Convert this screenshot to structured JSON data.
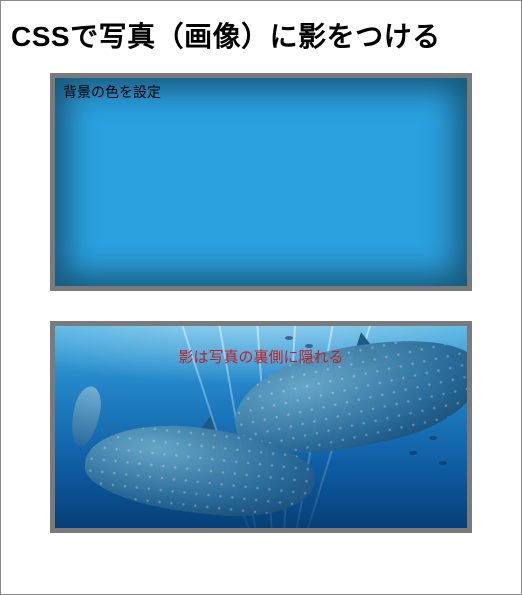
{
  "title": "CSSで写真（画像）に影をつける",
  "box1": {
    "label": "背景の色を設定",
    "bg_color": "#2aa0df"
  },
  "box2": {
    "caption": "影は写真の裏側に隠れる",
    "caption_color": "#c81e1e",
    "image_description": "underwater-whale-sharks"
  }
}
